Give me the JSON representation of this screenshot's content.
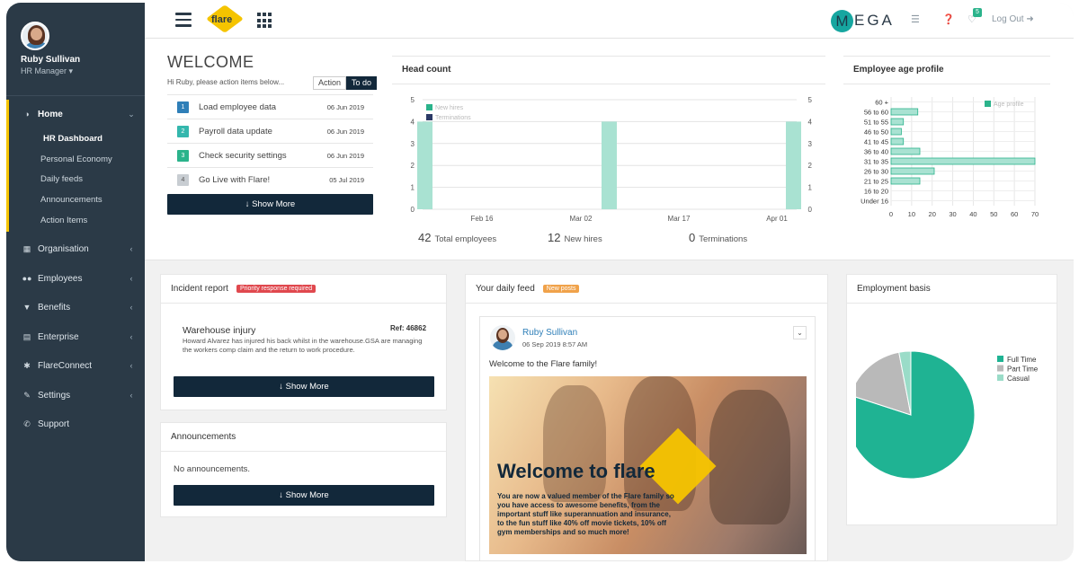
{
  "sidebar": {
    "user_name": "Ruby Sullivan",
    "user_role": "HR Manager ▾",
    "home": {
      "label": "Home",
      "icon": "dashboard-icon"
    },
    "home_items": [
      "HR Dashboard",
      "Personal Economy",
      "Daily feeds",
      "Announcements",
      "Action Items"
    ],
    "items": [
      {
        "label": "Organisation",
        "icon": "bank-icon"
      },
      {
        "label": "Employees",
        "icon": "users-icon"
      },
      {
        "label": "Benefits",
        "icon": "trophy-icon"
      },
      {
        "label": "Enterprise",
        "icon": "sitemap-icon"
      },
      {
        "label": "FlareConnect",
        "icon": "flare-connect-icon"
      },
      {
        "label": "Settings",
        "icon": "edit-icon"
      },
      {
        "label": "Support",
        "icon": "phone-icon"
      }
    ]
  },
  "header": {
    "logo_text": "flare",
    "mega_m": "M",
    "mega_rest": "EGA",
    "notification_count": "5",
    "logout": "Log Out"
  },
  "welcome": {
    "title": "WELCOME",
    "subtitle": "Hi Ruby, please action items below...",
    "tab_action": "Action",
    "tab_todo": "To do",
    "items": [
      {
        "num": "1",
        "label": "Load employee data",
        "date": "06 Jun 2019",
        "color": "#2f7fb8"
      },
      {
        "num": "2",
        "label": "Payroll data update",
        "date": "06 Jun 2019",
        "color": "#34b7ad"
      },
      {
        "num": "3",
        "label": "Check security settings",
        "date": "06 Jun 2019",
        "color": "#2bb38b"
      },
      {
        "num": "4",
        "label": "Go Live with Flare!",
        "date": "05 Jul 2019",
        "color": "#c8cdd2"
      }
    ],
    "show_more": "↓ Show More"
  },
  "headcount": {
    "title": "Head count",
    "total_num": "42",
    "total_label": "Total employees",
    "new_num": "12",
    "new_label": "New hires",
    "term_num": "0",
    "term_label": "Terminations"
  },
  "age_profile": {
    "title": "Employee age profile"
  },
  "incident": {
    "title": "Incident report",
    "tag": "Priority response required",
    "item_title": "Warehouse injury",
    "ref": "Ref: 46862",
    "body": "Howard Alvarez has injured his back whilst in the warehouse.GSA are managing the workers comp claim and the return to work procedure.",
    "show_more": "↓ Show More"
  },
  "announcements": {
    "title": "Announcements",
    "empty": "No announcements.",
    "show_more": "↓ Show More"
  },
  "feed": {
    "title": "Your daily feed",
    "tag": "New posts",
    "author": "Ruby Sullivan",
    "time": "06 Sep 2019 8:57 AM",
    "text": "Welcome to the Flare family!",
    "banner_title_a": "Welcome to ",
    "banner_title_b": "flare",
    "banner_body": "You are now a valued member of the Flare family so you have access to awesome benefits, from the important stuff like superannuation and insurance, to the fun stuff like 40% off movie tickets, 10% off gym memberships and so much more!"
  },
  "employment": {
    "title": "Employment basis"
  },
  "colors": {
    "teal": "#2bb38b",
    "navy": "#12283a",
    "yellow": "#f5c400",
    "priority": "#e0484e",
    "new_posts": "#f0a24a"
  },
  "chart_data": [
    {
      "type": "bar",
      "title": "Head count",
      "categories": [
        "Feb 16",
        "Mar 02",
        "Mar 17",
        "Apr 01"
      ],
      "series": [
        {
          "name": "New hires",
          "x": [
            "Feb 10",
            "Mar 05",
            "Apr 04"
          ],
          "values": [
            4,
            4,
            4
          ]
        },
        {
          "name": "Terminations",
          "values": [
            0,
            0,
            0
          ]
        }
      ],
      "ylim": [
        0,
        5
      ],
      "yticks": [
        "0",
        "1",
        "2",
        "3",
        "4",
        "5"
      ],
      "legend": "top-left",
      "grid": true
    },
    {
      "type": "bar",
      "orientation": "horizontal",
      "title": "Employee age profile",
      "categories": [
        "60 +",
        "56 to 60",
        "51 to 55",
        "46 to 50",
        "41 to 45",
        "36 to 40",
        "31 to 35",
        "26 to 30",
        "21 to 25",
        "16 to 20",
        "Under 16"
      ],
      "series": [
        {
          "name": "Age profile",
          "values": [
            0,
            13,
            6,
            5,
            6,
            14,
            70,
            21,
            14,
            0,
            0
          ]
        }
      ],
      "xlim": [
        0,
        70
      ],
      "xticks": [
        "0",
        "10",
        "20",
        "30",
        "40",
        "50",
        "60",
        "70"
      ],
      "legend": "top-right",
      "grid": true
    },
    {
      "type": "pie",
      "title": "Employment basis",
      "labels": [
        "Full Time",
        "Part Time",
        "Casual"
      ],
      "values": [
        80,
        17,
        3
      ],
      "colors": [
        "#1fb393",
        "#b9b9b9",
        "#9adcc8"
      ],
      "legend": "right"
    }
  ]
}
